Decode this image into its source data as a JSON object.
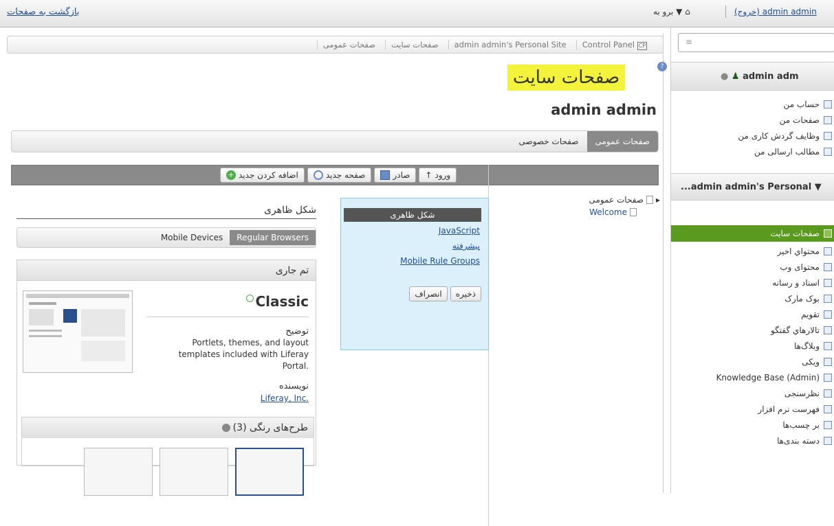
{
  "topbar": {
    "back_link": "بازگشت به صفحات",
    "goto_menu": "▼ برو به",
    "user_name": "admin admin",
    "user_exit": "(خروج)"
  },
  "breadcrumb": [
    "Control Panel",
    "admin admin's Personal Site",
    "صفحات سایت",
    "صفحات عمومی"
  ],
  "page": {
    "title": "صفحات سایت",
    "user_title": "admin admin",
    "tabs": [
      "صفحات عمومی",
      "صفحات خصوصی"
    ]
  },
  "toolbar": {
    "import": "ورود",
    "export": "صادر",
    "add_page": "صفحه جدید",
    "add_new": "اضافه کردن جدید"
  },
  "tree": {
    "root": "صفحات عمومی",
    "child": "Welcome"
  },
  "nav_menu": {
    "active": "شکل ظاهری",
    "links": [
      "JavaScript",
      "پیشرفته",
      "Mobile Rule Groups"
    ],
    "save": "ذخیره",
    "cancel": "انصراف"
  },
  "appearance": {
    "title": "شکل ظاهری",
    "device_tabs": [
      "Regular Browsers",
      "Mobile Devices"
    ],
    "current_theme_label": "تم جاری",
    "theme_name": "Classic",
    "description_label": "توضیح",
    "description": "Portlets, themes, and layout templates included with Liferay Portal.",
    "author_label": "نویسنده",
    "author": "Liferay, Inc.",
    "color_schemes": "طرح‌های رنگی (3)"
  },
  "sidebar": {
    "user": "admin adm",
    "my_items": [
      "حساب من",
      "صفحات من",
      "وظایف گردش کاری من",
      "مطالب ارسالی من"
    ],
    "site_selector": "...admin admin's Personal ▼",
    "active_item": "صفحات سایت",
    "content_items": [
      "محتواي اخير",
      "محتوای وب",
      "اسناد و رسانه",
      "بوک مارک",
      "تقویم",
      "تالارهاي گفتگو",
      "وبلاگ‌ها",
      "ویکی",
      "(Knowledge Base (Admin",
      "نظرسنجی",
      "فهرست نرم افزار",
      "بر چسب‌ها",
      "دسته بندی‌ها"
    ]
  }
}
